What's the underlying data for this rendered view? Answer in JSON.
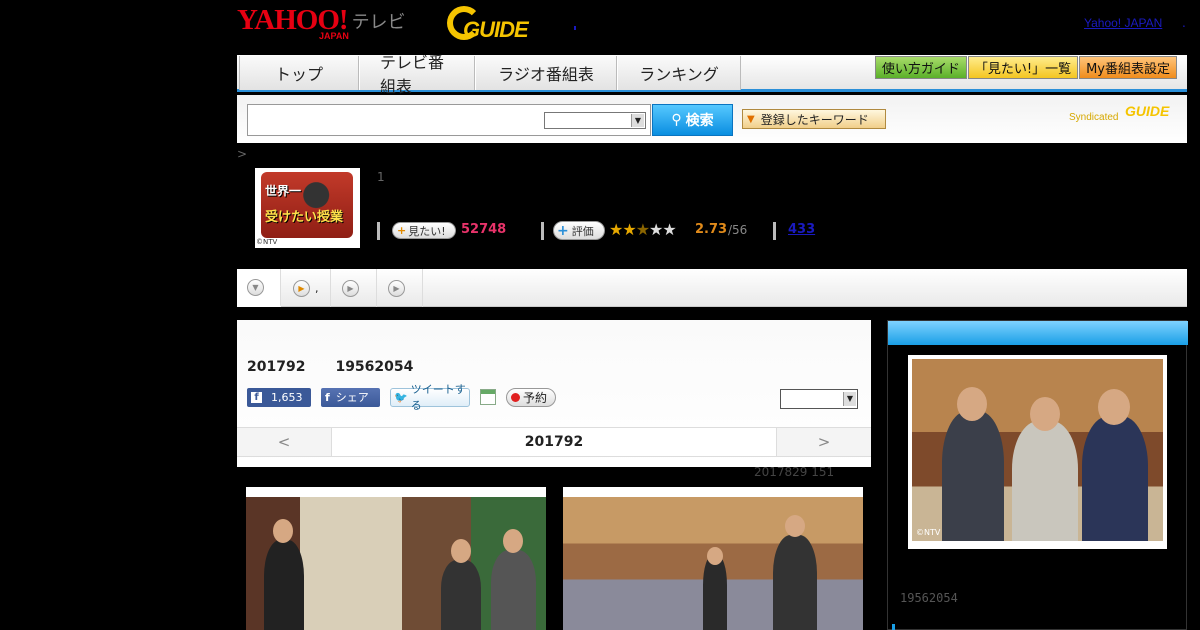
{
  "header": {
    "logo_yahoo": "YAHOO!",
    "logo_japan": "JAPAN",
    "logo_tv": "テレビ",
    "gguide": "GUIDE",
    "yahoo_japan_link": "Yahoo! JAPAN",
    "trailing_dot": "."
  },
  "nav": {
    "tabs": [
      {
        "label": "トップ"
      },
      {
        "label": "テレビ番組表"
      },
      {
        "label": "ラジオ番組表"
      },
      {
        "label": "ランキング"
      }
    ],
    "right_buttons": [
      {
        "label": "使い方ガイド"
      },
      {
        "label": "「見たい!」一覧"
      },
      {
        "label": "My番組表設定"
      }
    ]
  },
  "search": {
    "input_value": "",
    "select_value": "",
    "button_label": "検索",
    "keyword_button": "登録したキーワード",
    "syndicated": "Syndicated",
    "syndicated_logo": "GUIDE"
  },
  "breadcrumb": ">",
  "program": {
    "thumb_line1": "世界一",
    "thumb_line2": "受けたい授業",
    "thumb_copyright": "©NTV",
    "number": "1",
    "mitai_label": "見たい!",
    "mitai_count": "52748",
    "hyoka_label": "評価",
    "stars_on": "★★",
    "stars_half": "★",
    "stars_off": "★★",
    "rating": "2.73",
    "rating_count": "/56",
    "review_count": "433"
  },
  "tabstrip": {
    "tab2_text": ","
  },
  "episode": {
    "date": "201792",
    "id": "19562054",
    "fb_count": "1,653",
    "fb_share": "シェア",
    "tweet": "ツイートする",
    "reserve": "予約",
    "sort_value": "",
    "pager_prev": "<",
    "pager_current": "201792",
    "pager_next": ">",
    "updated": "2017829  151"
  },
  "sidebar": {
    "photo_copyright": "©NTV",
    "episode_id": "19562054"
  },
  "colors": {
    "accent_blue": "#2a8fd8",
    "mitai_pink": "#e8336a",
    "rating_orange": "#e08a1a",
    "gguide_yellow": "#f5c400"
  }
}
